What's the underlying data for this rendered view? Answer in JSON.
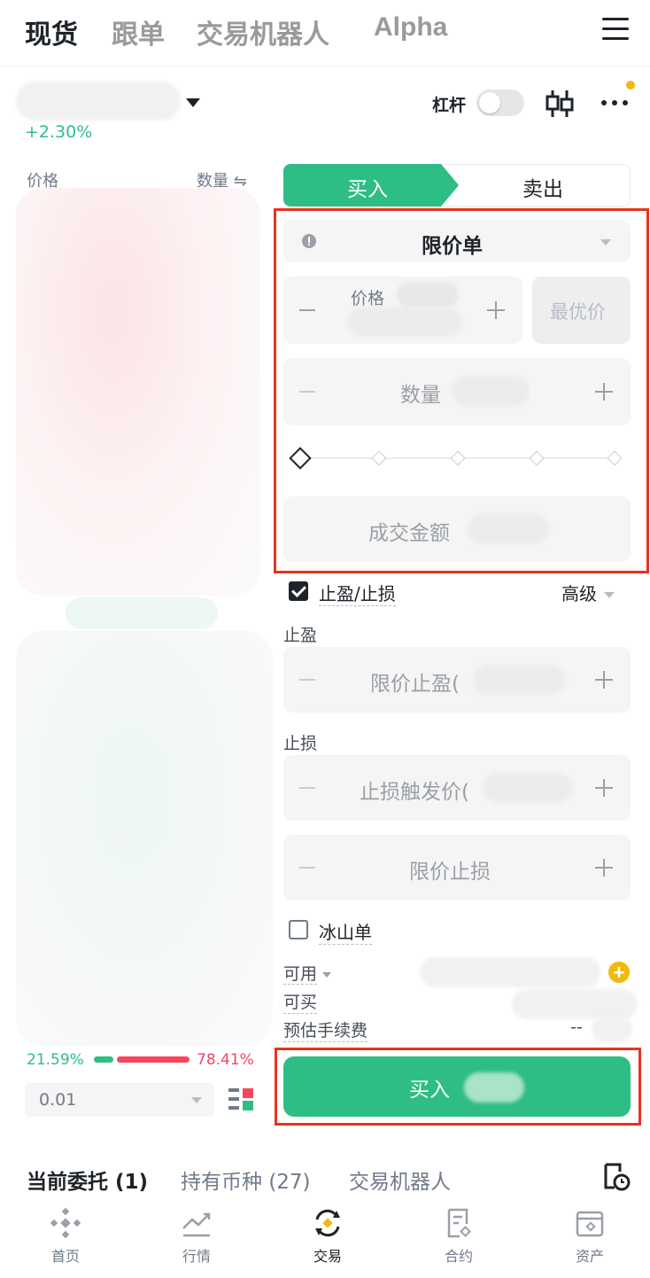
{
  "top_tabs": [
    "现货",
    "跟单",
    "交易机器人",
    "Alpha"
  ],
  "pair": {
    "change": "+2.30%"
  },
  "header": {
    "leverage_label": "杠杆"
  },
  "orderbook": {
    "price_header": "价格",
    "qty_header": "数量",
    "buy_ratio": "21.59%",
    "sell_ratio": "78.41%",
    "buy_ratio_value": 21.59,
    "depth_value": "0.01"
  },
  "tabs": {
    "buy": "买入",
    "sell": "卖出"
  },
  "order_form": {
    "order_type": "限价单",
    "price_label": "价格",
    "best_price": "最优价",
    "quantity_placeholder": "数量",
    "amount_placeholder": "成交金额"
  },
  "tpsl": {
    "label": "止盈/止损",
    "advanced": "高级",
    "take_profit_title": "止盈",
    "take_profit_placeholder": "限价止盈(",
    "stop_loss_title": "止损",
    "stop_trigger_placeholder": "止损触发价(",
    "stop_limit_placeholder": "限价止损"
  },
  "iceberg": {
    "label": "冰山单"
  },
  "balances": {
    "available": "可用",
    "can_buy": "可买",
    "fee": "预估手续费",
    "fee_value": "--"
  },
  "buy_button": "买入",
  "bottom_tabs": {
    "open_orders": "当前委托",
    "open_orders_count": "(1)",
    "holdings": "持有币种",
    "holdings_count": "(27)",
    "bots": "交易机器人"
  },
  "nav": [
    "首页",
    "行情",
    "交易",
    "合约",
    "资产"
  ],
  "colors": {
    "green": "#2ebd85",
    "red": "#f6465d",
    "highlight": "#e8321f",
    "accent": "#f0b90b"
  }
}
